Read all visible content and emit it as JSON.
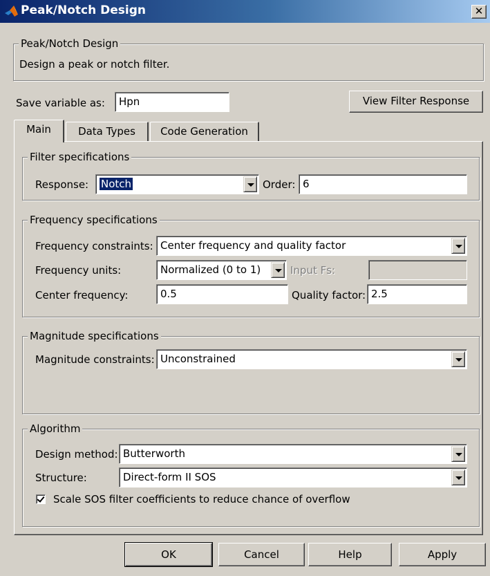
{
  "window": {
    "title": "Peak/Notch Design",
    "close_glyph": "✕",
    "icon": "matlab-icon"
  },
  "header_group": {
    "legend": "Peak/Notch Design",
    "description": "Design a peak or notch filter."
  },
  "save_variable": {
    "label": "Save variable as:",
    "value": "Hpn"
  },
  "view_response_button": "View Filter Response",
  "tabs": [
    {
      "label": "Main",
      "active": true
    },
    {
      "label": "Data Types",
      "active": false
    },
    {
      "label": "Code Generation",
      "active": false
    }
  ],
  "filter_specs": {
    "legend": "Filter specifications",
    "response_label": "Response:",
    "response_value": "Notch",
    "order_label": "Order:",
    "order_value": "6"
  },
  "frequency_specs": {
    "legend": "Frequency specifications",
    "constraints_label": "Frequency constraints:",
    "constraints_value": "Center frequency and quality factor",
    "units_label": "Frequency units:",
    "units_value": "Normalized (0 to 1)",
    "input_fs_label": "Input Fs:",
    "input_fs_value": "",
    "center_label": "Center frequency:",
    "center_value": "0.5",
    "quality_label": "Quality factor:",
    "quality_value": "2.5"
  },
  "magnitude_specs": {
    "legend": "Magnitude specifications",
    "constraints_label": "Magnitude constraints:",
    "constraints_value": "Unconstrained"
  },
  "algorithm": {
    "legend": "Algorithm",
    "design_method_label": "Design method:",
    "design_method_value": "Butterworth",
    "structure_label": "Structure:",
    "structure_value": "Direct-form II SOS",
    "scale_label": "Scale SOS filter coefficients to reduce chance of overflow",
    "scale_checked": true
  },
  "buttons": {
    "ok": "OK",
    "cancel": "Cancel",
    "help": "Help",
    "apply": "Apply"
  }
}
